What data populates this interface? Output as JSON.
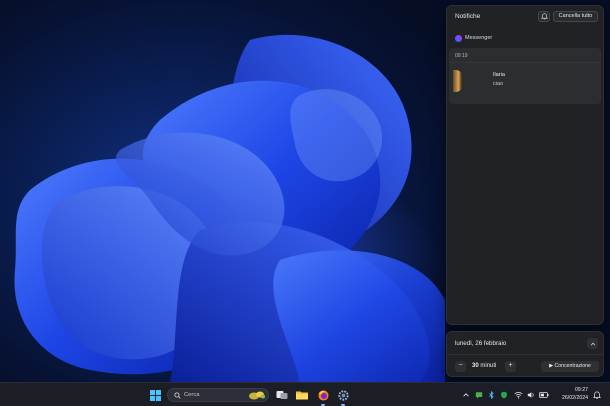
{
  "notifications": {
    "title": "Notifiche",
    "clear_all_label": "Cancella tutto",
    "app_name": "Messenger",
    "items": [
      {
        "time": "09:19",
        "sender": "Ilaria",
        "message": "ciao"
      }
    ]
  },
  "calendar": {
    "date_label": "lunedì, 26 febbraio",
    "focus_minutes": "30",
    "focus_unit": "minuti",
    "focus_button_label": "Concentrazione"
  },
  "taskbar": {
    "search_placeholder": "Cerca",
    "clock_time": "09:27",
    "clock_date": "26/02/2024"
  },
  "colors": {
    "accent": "#0a7cff",
    "panel_bg": "#202225",
    "taskbar_bg": "#1c1e26"
  },
  "icons": {
    "start": "windows-logo-icon",
    "search": "search-icon",
    "task_view": "task-view-icon",
    "file_explorer": "folder-icon",
    "firefox": "firefox-icon",
    "settings": "gear-icon",
    "notification_bell": "bell-icon"
  }
}
